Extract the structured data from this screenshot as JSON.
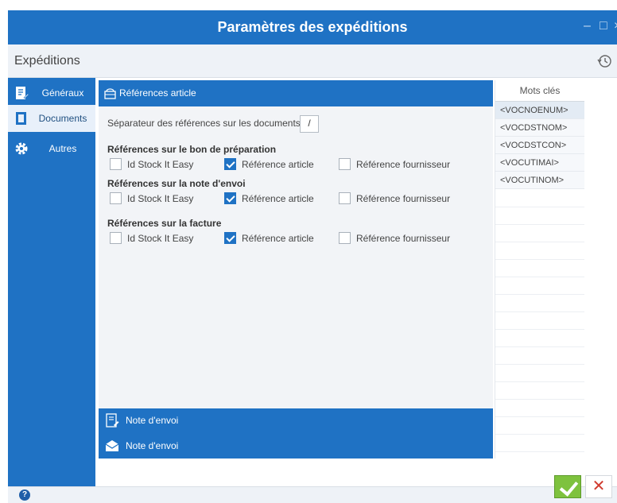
{
  "window": {
    "title": "Paramètres des expéditions",
    "minimize": "–",
    "maximize": "□",
    "close": "×"
  },
  "header": {
    "breadcrumb": "Expéditions",
    "history_icon": "history-icon"
  },
  "sidebar": {
    "items": [
      {
        "label": "Généraux",
        "icon": "document-edit-icon",
        "active": false
      },
      {
        "label": "Documents",
        "icon": "document-icon",
        "active": true
      },
      {
        "label": "Autres",
        "icon": "gear-icon",
        "active": false
      }
    ]
  },
  "main": {
    "section_title": "Références article",
    "separator_label": "Séparateur des références sur les documents",
    "separator_value": "/",
    "groups": [
      {
        "title": "Références sur le bon de préparation",
        "options": [
          {
            "label": "Id Stock It Easy",
            "checked": false
          },
          {
            "label": "Référence article",
            "checked": true
          },
          {
            "label": "Référence fournisseur",
            "checked": false
          }
        ]
      },
      {
        "title": "Références sur la note d'envoi",
        "options": [
          {
            "label": "Id Stock It Easy",
            "checked": false
          },
          {
            "label": "Référence article",
            "checked": true
          },
          {
            "label": "Référence fournisseur",
            "checked": false
          }
        ]
      },
      {
        "title": "Références sur la facture",
        "options": [
          {
            "label": "Id Stock It Easy",
            "checked": false
          },
          {
            "label": "Référence article",
            "checked": true
          },
          {
            "label": "Référence fournisseur",
            "checked": false
          }
        ]
      }
    ],
    "bottom_items": [
      {
        "label": "Note d'envoi",
        "icon": "document-edit-icon"
      },
      {
        "label": "Note d'envoi",
        "icon": "envelope-icon"
      }
    ]
  },
  "keywords": {
    "header": "Mots clés",
    "items": [
      "<VOCNOENUM>",
      "<VOCDSTNOM>",
      "<VOCDSTCON>",
      "<VOCUTIMAI>",
      "<VOCUTINOM>"
    ]
  },
  "footer": {
    "help": "?",
    "ok_icon": "checkmark-icon",
    "cancel": "✕"
  },
  "colors": {
    "accent": "#1f72c4",
    "panel": "#f2f4f7",
    "ok": "#7ec23e",
    "cancel": "#d03b2f"
  }
}
